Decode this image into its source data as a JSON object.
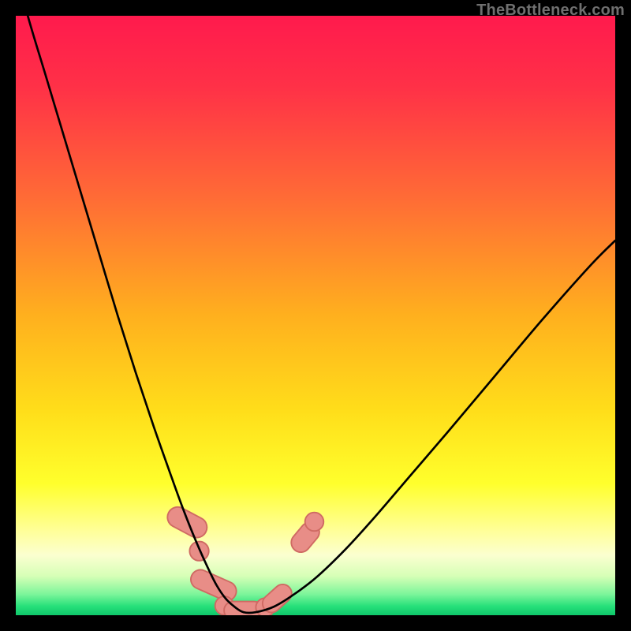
{
  "watermark": {
    "text": "TheBottleneck.com"
  },
  "colors": {
    "black": "#000000",
    "curve": "#000000",
    "marker_fill": "#e88d87",
    "marker_stroke": "#cf6a63"
  },
  "chart_data": {
    "type": "line",
    "title": "",
    "xlabel": "",
    "ylabel": "",
    "xlim": [
      0,
      100
    ],
    "ylim": [
      0,
      100
    ],
    "grid": false,
    "legend": null,
    "annotations": [],
    "gradient_stops": [
      {
        "pos": 0.0,
        "color": "#ff1a4d"
      },
      {
        "pos": 0.12,
        "color": "#ff3147"
      },
      {
        "pos": 0.3,
        "color": "#ff6a36"
      },
      {
        "pos": 0.5,
        "color": "#ffb01e"
      },
      {
        "pos": 0.66,
        "color": "#ffde1a"
      },
      {
        "pos": 0.78,
        "color": "#ffff2c"
      },
      {
        "pos": 0.86,
        "color": "#ffff9a"
      },
      {
        "pos": 0.9,
        "color": "#fbffd0"
      },
      {
        "pos": 0.935,
        "color": "#d6ffb6"
      },
      {
        "pos": 0.965,
        "color": "#7cf59a"
      },
      {
        "pos": 0.985,
        "color": "#26e07a"
      },
      {
        "pos": 1.0,
        "color": "#0fc76a"
      }
    ],
    "series": [
      {
        "name": "bottleneck-curve",
        "x": [
          0,
          2,
          5,
          8,
          11,
          14,
          17,
          20,
          23,
          26,
          28,
          30,
          32,
          33.5,
          35,
          36.5,
          38,
          40,
          43,
          46,
          50,
          55,
          60,
          66,
          72,
          80,
          88,
          96,
          100
        ],
        "y": [
          108,
          100,
          90,
          80,
          70,
          60,
          50,
          40.5,
          31.5,
          23,
          17.5,
          12.5,
          8,
          5,
          2.8,
          1.4,
          0.5,
          0.5,
          1.4,
          3.2,
          6.2,
          11,
          16.5,
          23.5,
          30.5,
          40,
          49.5,
          58.5,
          62.5
        ]
      }
    ],
    "markers": [
      {
        "shape": "round-rect",
        "cx": 28.6,
        "cy": 15.5,
        "w": 3.4,
        "h": 7.0,
        "rot": -62
      },
      {
        "shape": "circle",
        "cx": 30.6,
        "cy": 10.7,
        "r": 1.6
      },
      {
        "shape": "round-rect",
        "cx": 33.0,
        "cy": 5.0,
        "w": 3.2,
        "h": 8.0,
        "rot": -66
      },
      {
        "shape": "circle",
        "cx": 34.8,
        "cy": 1.6,
        "r": 1.55
      },
      {
        "shape": "round-rect",
        "cx": 38.0,
        "cy": 0.8,
        "w": 6.5,
        "h": 3.0,
        "rot": 0
      },
      {
        "shape": "circle",
        "cx": 41.6,
        "cy": 1.3,
        "r": 1.55
      },
      {
        "shape": "round-rect",
        "cx": 43.6,
        "cy": 2.8,
        "w": 3.0,
        "h": 5.5,
        "rot": 48
      },
      {
        "shape": "round-rect",
        "cx": 48.3,
        "cy": 13.0,
        "w": 3.2,
        "h": 5.5,
        "rot": 40
      },
      {
        "shape": "circle",
        "cx": 49.8,
        "cy": 15.6,
        "r": 1.55
      }
    ]
  }
}
